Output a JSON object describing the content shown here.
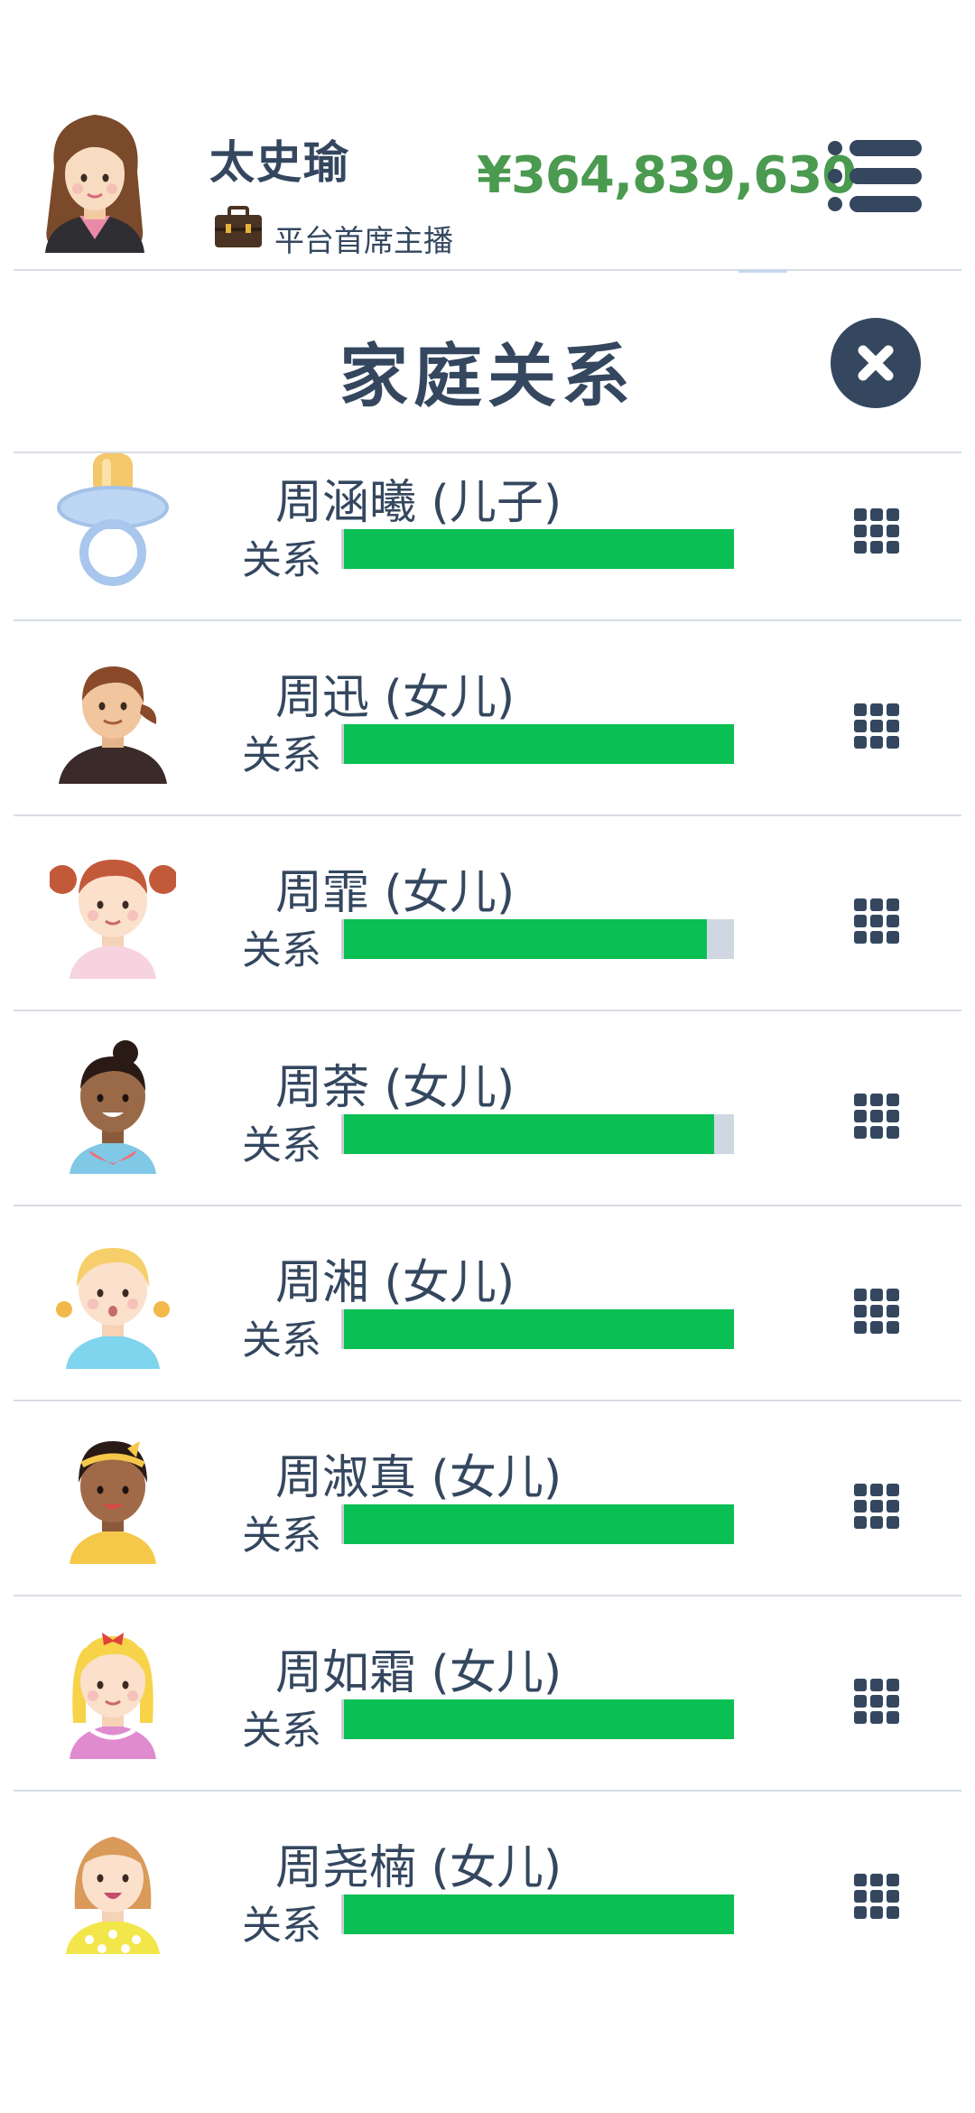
{
  "player": {
    "name": "太史瑜",
    "title": "平台首席主播",
    "money": "¥364,839,630",
    "avatar_icon": "woman-avatar-icon",
    "title_icon": "briefcase-icon"
  },
  "menu": {
    "icon": "menu-list-icon"
  },
  "dialog": {
    "title": "家庭关系",
    "close_icon": "close-icon"
  },
  "colors": {
    "text": "#34475f",
    "money": "#4a9a4f",
    "bar_fill": "#0abf53",
    "bar_track": "#cfd8e2"
  },
  "family": [
    {
      "name": "周涵曦 (儿子)",
      "label": "关系",
      "relation": 1.0,
      "avatar": "pacifier-icon",
      "action_icon": "grid-icon"
    },
    {
      "name": "周迅 (女儿)",
      "label": "关系",
      "relation": 1.0,
      "avatar": "child-avatar-icon",
      "action_icon": "grid-icon"
    },
    {
      "name": "周霏 (女儿)",
      "label": "关系",
      "relation": 0.93,
      "avatar": "girl-pigtails-avatar-icon",
      "action_icon": "grid-icon"
    },
    {
      "name": "周荼 (女儿)",
      "label": "关系",
      "relation": 0.95,
      "avatar": "girl-bun-avatar-icon",
      "action_icon": "grid-icon"
    },
    {
      "name": "周湘 (女儿)",
      "label": "关系",
      "relation": 1.0,
      "avatar": "blonde-girl-avatar-icon",
      "action_icon": "grid-icon"
    },
    {
      "name": "周淑真 (女儿)",
      "label": "关系",
      "relation": 1.0,
      "avatar": "girl-headband-avatar-icon",
      "action_icon": "grid-icon"
    },
    {
      "name": "周如霜 (女儿)",
      "label": "关系",
      "relation": 1.0,
      "avatar": "blonde-bow-avatar-icon",
      "action_icon": "grid-icon"
    },
    {
      "name": "周尧楠 (女儿)",
      "label": "关系",
      "relation": 1.0,
      "avatar": "girl-polka-avatar-icon",
      "action_icon": "grid-icon"
    }
  ]
}
